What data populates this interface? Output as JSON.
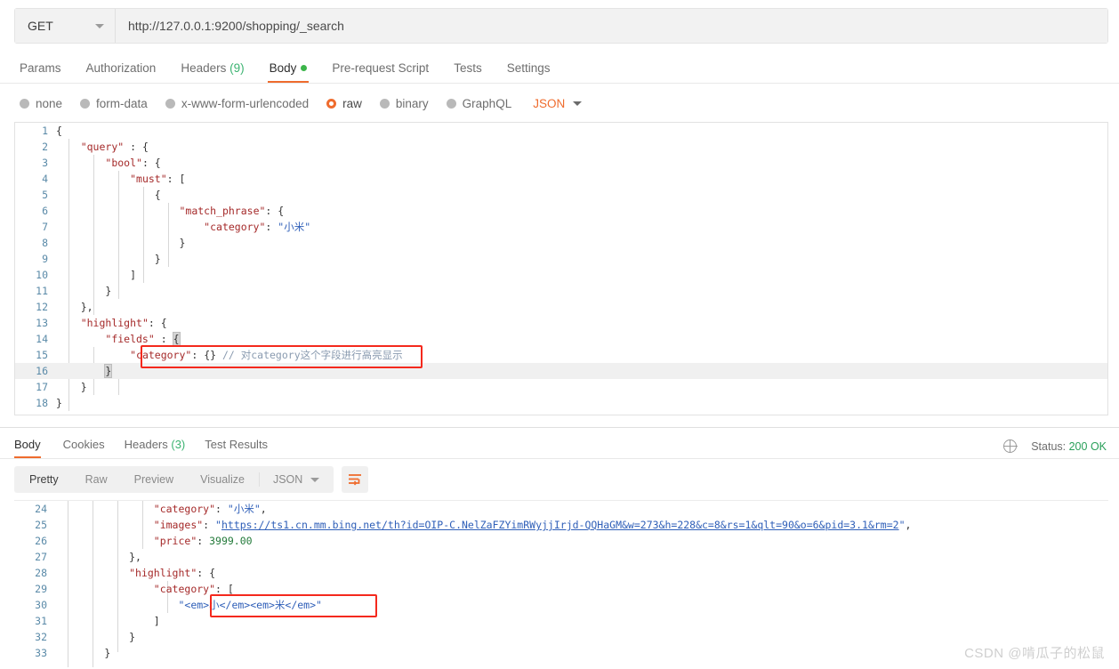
{
  "request": {
    "method": "GET",
    "url": "http://127.0.0.1:9200/shopping/_search",
    "tabs": [
      {
        "label": "Params",
        "active": false
      },
      {
        "label": "Authorization",
        "active": false
      },
      {
        "label": "Headers",
        "count": "(9)",
        "active": false
      },
      {
        "label": "Body",
        "active": true,
        "dot": true
      },
      {
        "label": "Pre-request Script",
        "active": false
      },
      {
        "label": "Tests",
        "active": false
      },
      {
        "label": "Settings",
        "active": false
      }
    ],
    "body_types": [
      {
        "label": "none",
        "selected": false
      },
      {
        "label": "form-data",
        "selected": false
      },
      {
        "label": "x-www-form-urlencoded",
        "selected": false
      },
      {
        "label": "raw",
        "selected": true
      },
      {
        "label": "binary",
        "selected": false
      },
      {
        "label": "GraphQL",
        "selected": false
      }
    ],
    "format_select": "JSON",
    "code_lines": [
      {
        "n": "1",
        "tokens": [
          {
            "t": "{",
            "c": "p"
          }
        ]
      },
      {
        "n": "2",
        "tokens": [
          {
            "t": "    ",
            "c": "p"
          },
          {
            "t": "\"query\"",
            "c": "k"
          },
          {
            "t": " : {",
            "c": "p"
          }
        ]
      },
      {
        "n": "3",
        "tokens": [
          {
            "t": "        ",
            "c": "p"
          },
          {
            "t": "\"bool\"",
            "c": "k"
          },
          {
            "t": ": {",
            "c": "p"
          }
        ]
      },
      {
        "n": "4",
        "tokens": [
          {
            "t": "            ",
            "c": "p"
          },
          {
            "t": "\"must\"",
            "c": "k"
          },
          {
            "t": ": [",
            "c": "p"
          }
        ]
      },
      {
        "n": "5",
        "tokens": [
          {
            "t": "                {",
            "c": "p"
          }
        ]
      },
      {
        "n": "6",
        "tokens": [
          {
            "t": "                    ",
            "c": "p"
          },
          {
            "t": "\"match_phrase\"",
            "c": "k"
          },
          {
            "t": ": {",
            "c": "p"
          }
        ]
      },
      {
        "n": "7",
        "tokens": [
          {
            "t": "                        ",
            "c": "p"
          },
          {
            "t": "\"category\"",
            "c": "k"
          },
          {
            "t": ": ",
            "c": "p"
          },
          {
            "t": "\"小米\"",
            "c": "s"
          }
        ]
      },
      {
        "n": "8",
        "tokens": [
          {
            "t": "                    }",
            "c": "p"
          }
        ]
      },
      {
        "n": "9",
        "tokens": [
          {
            "t": "                }",
            "c": "p"
          }
        ]
      },
      {
        "n": "10",
        "tokens": [
          {
            "t": "            ]",
            "c": "p"
          }
        ]
      },
      {
        "n": "11",
        "tokens": [
          {
            "t": "        }",
            "c": "p"
          }
        ]
      },
      {
        "n": "12",
        "tokens": [
          {
            "t": "    },",
            "c": "p"
          }
        ]
      },
      {
        "n": "13",
        "tokens": [
          {
            "t": "    ",
            "c": "p"
          },
          {
            "t": "\"highlight\"",
            "c": "k"
          },
          {
            "t": ": {",
            "c": "p"
          }
        ]
      },
      {
        "n": "14",
        "tokens": [
          {
            "t": "        ",
            "c": "p"
          },
          {
            "t": "\"fields\"",
            "c": "k"
          },
          {
            "t": " : ",
            "c": "p"
          },
          {
            "t": "{",
            "c": "cursor"
          }
        ]
      },
      {
        "n": "15",
        "tokens": [
          {
            "t": "            ",
            "c": "p"
          },
          {
            "t": "\"category\"",
            "c": "k"
          },
          {
            "t": ": {} ",
            "c": "p"
          },
          {
            "t": "// 对category这个字段进行高亮显示",
            "c": "cm"
          }
        ]
      },
      {
        "n": "16",
        "highlight": true,
        "tokens": [
          {
            "t": "        ",
            "c": "p"
          },
          {
            "t": "}",
            "c": "cursor"
          }
        ]
      },
      {
        "n": "17",
        "tokens": [
          {
            "t": "    }",
            "c": "p"
          }
        ]
      },
      {
        "n": "18",
        "tokens": [
          {
            "t": "}",
            "c": "p"
          }
        ]
      }
    ]
  },
  "response": {
    "tabs": [
      {
        "label": "Body",
        "active": true
      },
      {
        "label": "Cookies",
        "active": false
      },
      {
        "label": "Headers",
        "count": "(3)",
        "active": false
      },
      {
        "label": "Test Results",
        "active": false
      }
    ],
    "status_label": "Status:",
    "status_value": "200 OK",
    "view_modes": [
      {
        "label": "Pretty",
        "active": true
      },
      {
        "label": "Raw",
        "active": false
      },
      {
        "label": "Preview",
        "active": false
      },
      {
        "label": "Visualize",
        "active": false
      }
    ],
    "format_select": "JSON",
    "code_lines": [
      {
        "n": "24",
        "tokens": [
          {
            "t": "                ",
            "c": "p"
          },
          {
            "t": "\"category\"",
            "c": "k"
          },
          {
            "t": ": ",
            "c": "p"
          },
          {
            "t": "\"小米\"",
            "c": "s"
          },
          {
            "t": ",",
            "c": "p"
          }
        ]
      },
      {
        "n": "25",
        "tokens": [
          {
            "t": "                ",
            "c": "p"
          },
          {
            "t": "\"images\"",
            "c": "k"
          },
          {
            "t": ": ",
            "c": "p"
          },
          {
            "t": "\"",
            "c": "s"
          },
          {
            "t": "https://ts1.cn.mm.bing.net/th?id=OIP-C.NelZaFZYimRWyjjIrjd-QQHaGM&w=273&h=228&c=8&rs=1&qlt=90&o=6&pid=3.1&rm=2",
            "c": "lnk"
          },
          {
            "t": "\"",
            "c": "s"
          },
          {
            "t": ",",
            "c": "p"
          }
        ]
      },
      {
        "n": "26",
        "tokens": [
          {
            "t": "                ",
            "c": "p"
          },
          {
            "t": "\"price\"",
            "c": "k"
          },
          {
            "t": ": ",
            "c": "p"
          },
          {
            "t": "3999.00",
            "c": "n"
          }
        ]
      },
      {
        "n": "27",
        "tokens": [
          {
            "t": "            },",
            "c": "p"
          }
        ]
      },
      {
        "n": "28",
        "tokens": [
          {
            "t": "            ",
            "c": "p"
          },
          {
            "t": "\"highlight\"",
            "c": "k"
          },
          {
            "t": ": {",
            "c": "p"
          }
        ]
      },
      {
        "n": "29",
        "tokens": [
          {
            "t": "                ",
            "c": "p"
          },
          {
            "t": "\"category\"",
            "c": "k"
          },
          {
            "t": ": [",
            "c": "p"
          }
        ]
      },
      {
        "n": "30",
        "tokens": [
          {
            "t": "                    ",
            "c": "p"
          },
          {
            "t": "\"<em>小</em><em>米</em>\"",
            "c": "s"
          }
        ]
      },
      {
        "n": "31",
        "tokens": [
          {
            "t": "                ]",
            "c": "p"
          }
        ]
      },
      {
        "n": "32",
        "tokens": [
          {
            "t": "            }",
            "c": "p"
          }
        ]
      },
      {
        "n": "33",
        "tokens": [
          {
            "t": "        }",
            "c": "p"
          }
        ]
      }
    ]
  },
  "watermark": "CSDN @啃瓜子的松鼠",
  "colors": {
    "accent": "#ef6c2e",
    "status_ok": "#2aa05a",
    "annotation_box": "#f4291d"
  }
}
